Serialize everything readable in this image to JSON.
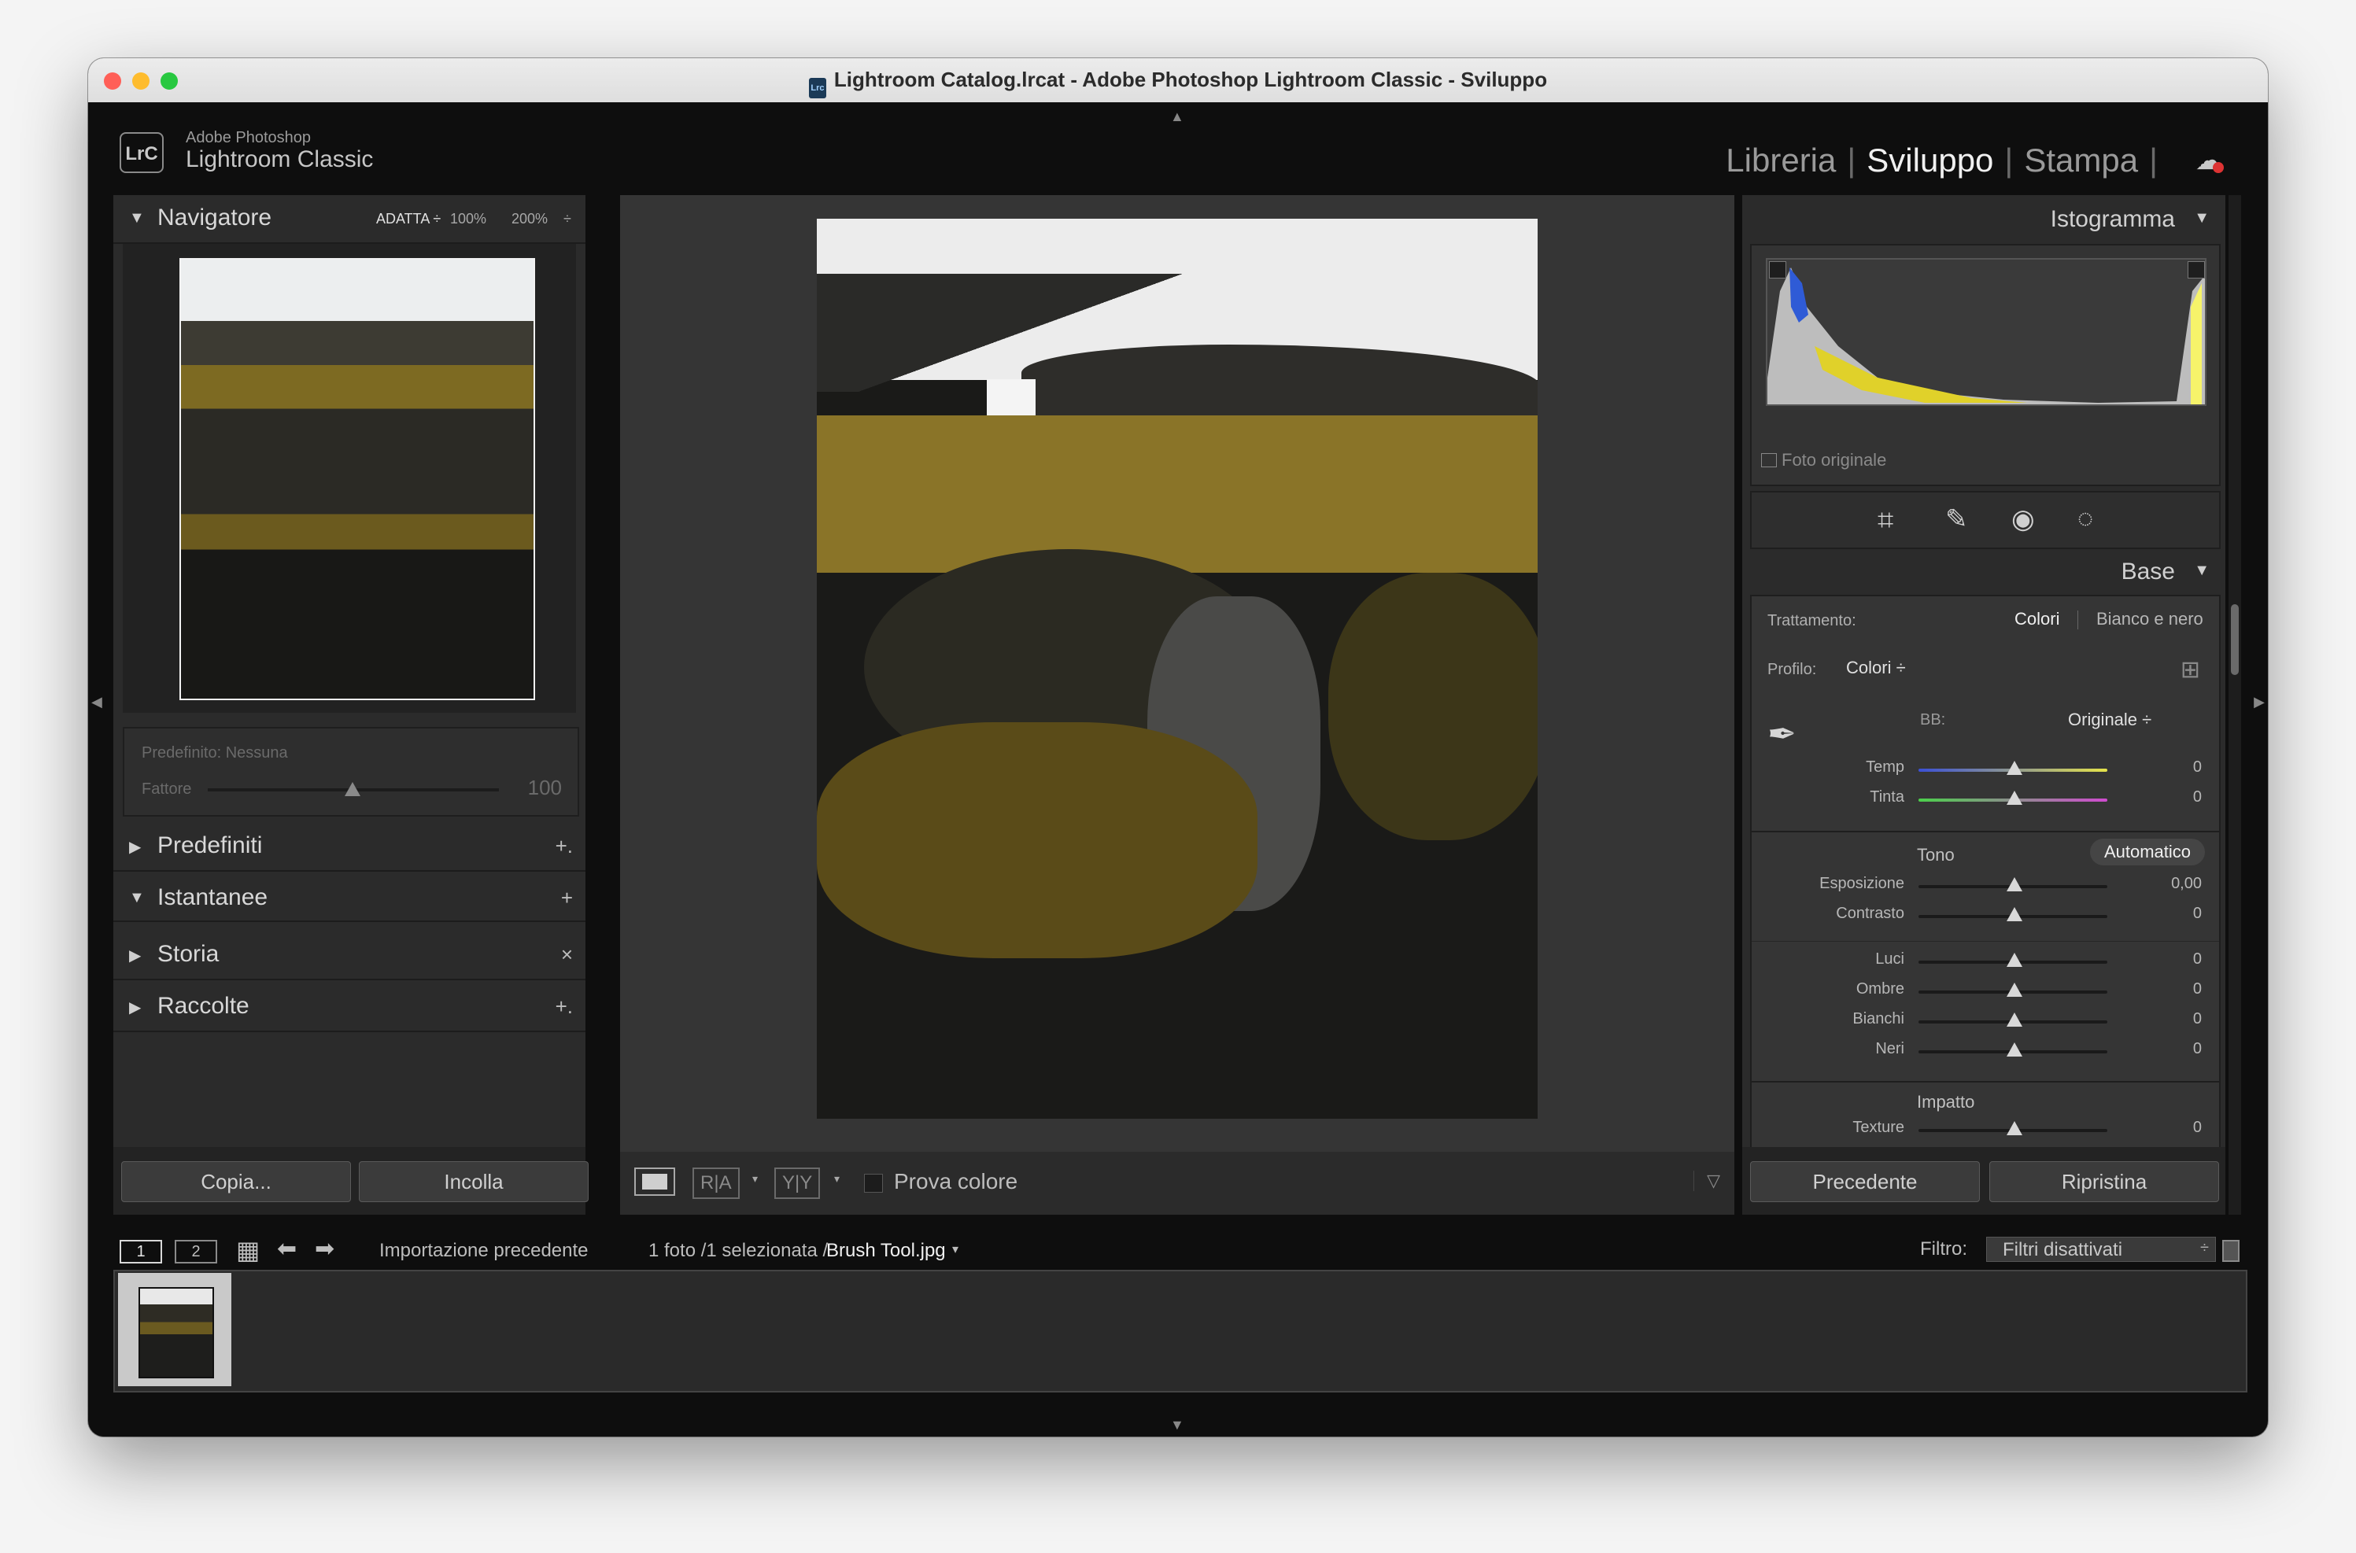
{
  "window": {
    "title": "Lightroom Catalog.lrcat - Adobe Photoshop Lightroom Classic - Sviluppo",
    "traffic_colors": [
      "#ff5f57",
      "#febc2e",
      "#28c840"
    ]
  },
  "brand": {
    "logo": "LrC",
    "line1": "Adobe Photoshop",
    "line2": "Lightroom Classic"
  },
  "modules": {
    "libreria": "Libreria",
    "sviluppo": "Sviluppo",
    "stampa": "Stampa"
  },
  "navigator": {
    "title": "Navigatore",
    "zoom": [
      "ADATTA ÷",
      "100%",
      "200%",
      "÷"
    ],
    "preset_label": "Predefinito: Nessuna",
    "factor_label": "Fattore",
    "factor_value": "100"
  },
  "left_panels": [
    {
      "label": "Predefiniti",
      "action": "+."
    },
    {
      "label": "Istantanee",
      "action": "+"
    },
    {
      "label": "Storia",
      "action": "×"
    },
    {
      "label": "Raccolte",
      "action": "+."
    }
  ],
  "left_buttons": {
    "copy": "Copia...",
    "paste": "Incolla"
  },
  "toolbar": {
    "view_ra": "R|A",
    "view_yy": "Y|Y",
    "soft_proof": "Prova colore"
  },
  "histogram": {
    "title": "Istogramma",
    "original_photo": "Foto originale"
  },
  "basic": {
    "title": "Base",
    "treatment_label": "Trattamento:",
    "treatment_color": "Colori",
    "treatment_bw": "Bianco e nero",
    "profile_label": "Profilo:",
    "profile_value": "Colori ÷",
    "wb_label": "BB:",
    "wb_value": "Originale ÷",
    "tone_label": "Tono",
    "auto_button": "Automatico",
    "presence_label": "Impatto",
    "sliders": [
      {
        "name": "Temp",
        "value": "0"
      },
      {
        "name": "Tinta",
        "value": "0"
      },
      {
        "name": "Esposizione",
        "value": "0,00"
      },
      {
        "name": "Contrasto",
        "value": "0"
      },
      {
        "name": "Luci",
        "value": "0"
      },
      {
        "name": "Ombre",
        "value": "0"
      },
      {
        "name": "Bianchi",
        "value": "0"
      },
      {
        "name": "Neri",
        "value": "0"
      },
      {
        "name": "Texture",
        "value": "0"
      }
    ]
  },
  "right_buttons": {
    "previous": "Precedente",
    "reset": "Ripristina"
  },
  "filmbar": {
    "screen1": "1",
    "screen2": "2",
    "source": "Importazione precedente",
    "count": "1 foto /1 selezionata /",
    "filename": "Brush Tool.jpg",
    "filter_label": "Filtro:",
    "filter_value": "Filtri disattivati"
  }
}
